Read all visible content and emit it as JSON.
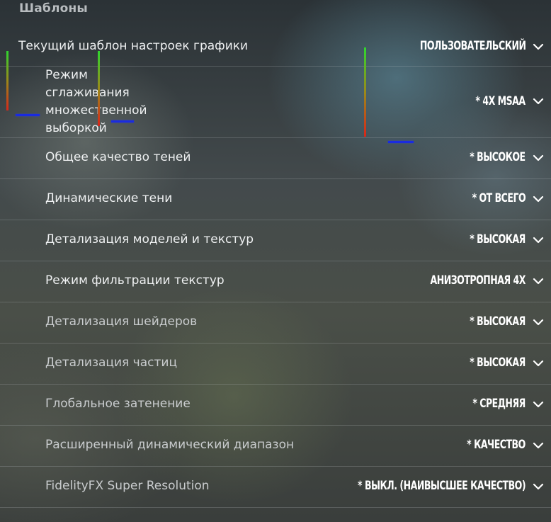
{
  "section_title": "Шаблоны",
  "rows": [
    {
      "label": "Текущий шаблон настроек графики",
      "value": "ПОЛЬЗОВАТЕЛЬСКИЙ"
    },
    {
      "label": "Режим сглаживания множественной выборкой",
      "value": "* 4X MSAA"
    },
    {
      "label": "Общее качество теней",
      "value": "* ВЫСОКОЕ"
    },
    {
      "label": "Динамические тени",
      "value": "* ОТ ВСЕГО"
    },
    {
      "label": "Детализация моделей и текстур",
      "value": "* ВЫСОКАЯ"
    },
    {
      "label": "Режим фильтрации текстур",
      "value": "АНИЗОТРОПНАЯ 4X"
    },
    {
      "label": "Детализация шейдеров",
      "value": "* ВЫСОКАЯ"
    },
    {
      "label": "Детализация частиц",
      "value": "* ВЫСОКАЯ"
    },
    {
      "label": "Глобальное затенение",
      "value": "* СРЕДНЯЯ"
    },
    {
      "label": "Расширенный динамический диапазон",
      "value": "* КАЧЕСТВО"
    },
    {
      "label": "FidelityFX Super Resolution",
      "value": "* ВЫКЛ. (НАИВЫСШЕЕ КАЧЕСТВО)"
    }
  ],
  "icons": {
    "dropdown": "chevron-down-icon"
  },
  "colors": {
    "label_text": "#eef0f1",
    "value_text": "#ffffff",
    "section_title": "#b8bcbf",
    "divider": "rgba(200,205,210,0.22)",
    "marker_top": "#2fd62f",
    "marker_bottom": "#d8261a",
    "marker_blue": "#1a2be0"
  }
}
